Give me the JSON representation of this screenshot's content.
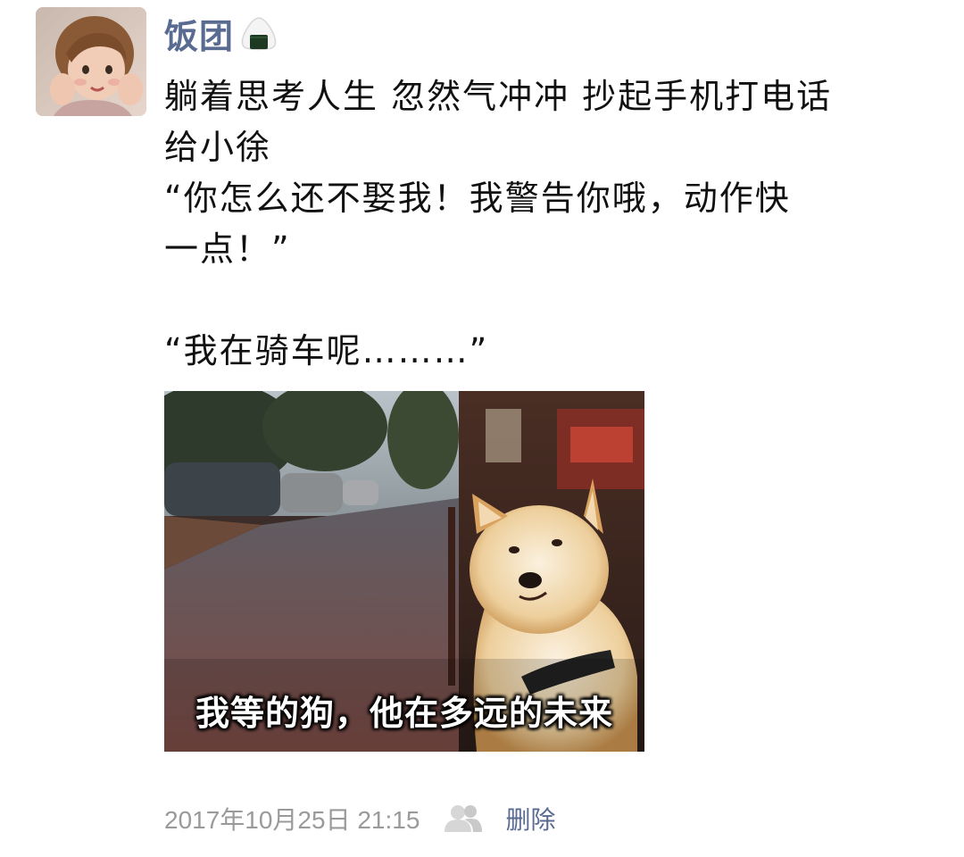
{
  "user": {
    "name": "饭团",
    "name_icon": "onigiri-icon",
    "avatar": "avatar-child"
  },
  "post": {
    "lines": [
      "躺着思考人生 忽然气冲冲 抄起手机打电话",
      "给小徐",
      "“你怎么还不娶我！我警告你哦，动作快",
      "一点！”",
      "",
      "“我在骑车呢………”"
    ],
    "image": {
      "caption": "我等的狗，他在多远的未来"
    }
  },
  "footer": {
    "timestamp": "2017年10月25日  21:15",
    "visibility_icon": "users-icon",
    "delete_label": "删除"
  },
  "colors": {
    "link_blue": "#5a6b92",
    "meta_gray": "#9a9a9a",
    "text": "#111111"
  }
}
